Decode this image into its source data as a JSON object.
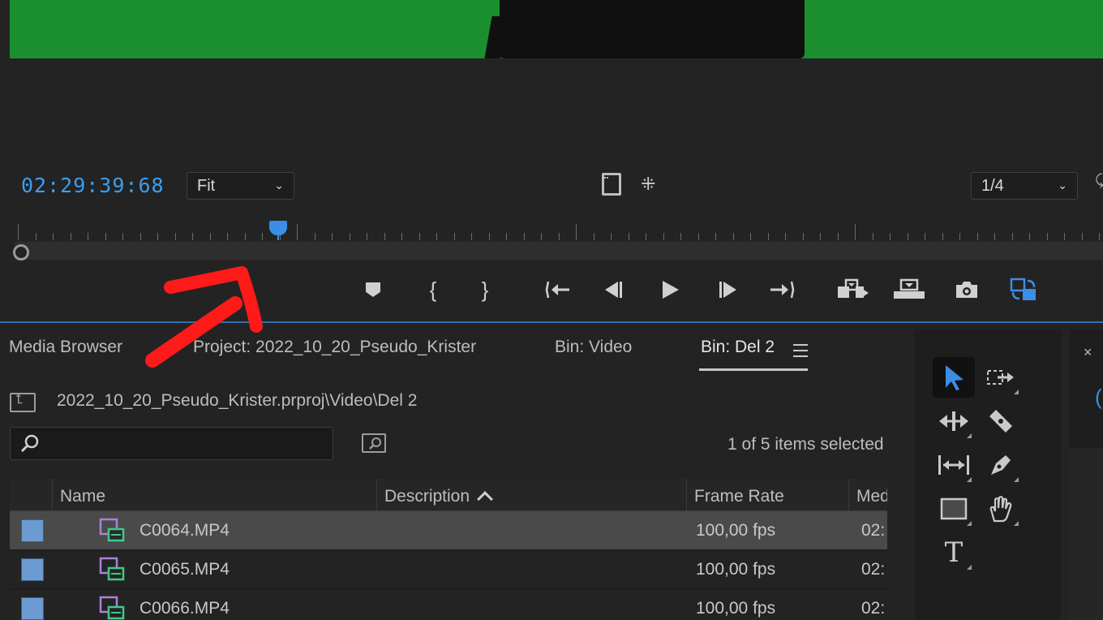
{
  "monitor": {
    "timecode": "02:29:39:68",
    "zoom_select": "Fit",
    "resolution_select": "1/4"
  },
  "transport": {
    "marker_icon": "marker-icon",
    "mark_in": "{",
    "mark_out": "}",
    "go_to_in": "{←",
    "step_back": "◀|",
    "play": "▶",
    "step_forward": "|▶",
    "go_to_out": "→}",
    "insert_icon": "insert-icon",
    "overwrite_icon": "overwrite-icon",
    "camera_icon": "camera-icon",
    "proxy_icon": "proxy-toggle-icon"
  },
  "tabs": [
    {
      "label": "Media Browser"
    },
    {
      "label": "Project: 2022_10_20_Pseudo_Krister"
    },
    {
      "label": "Bin: Video"
    },
    {
      "label": "Bin: Del 2"
    }
  ],
  "project": {
    "path": "2022_10_20_Pseudo_Krister.prproj\\Video\\Del 2",
    "search_placeholder": "",
    "selection_status": "1 of 5 items selected"
  },
  "table": {
    "columns": [
      "Name",
      "Description",
      "Frame Rate",
      "Med"
    ],
    "rows": [
      {
        "name": "C0064.MP4",
        "description": "",
        "frame_rate": "100,00 fps",
        "media": "02:",
        "selected": true
      },
      {
        "name": "C0065.MP4",
        "description": "",
        "frame_rate": "100,00 fps",
        "media": "02:",
        "selected": false
      },
      {
        "name": "C0066.MP4",
        "description": "",
        "frame_rate": "100,00 fps",
        "media": "02:",
        "selected": false
      }
    ]
  },
  "tools": {
    "type_tool": "T",
    "close": "×",
    "partial_panel_glyph": "("
  },
  "colors": {
    "accent_blue": "#3a8ee6",
    "green_screen": "#1b8f2e",
    "annotation_red": "#ff1a1a",
    "label_swatch": "#6c9bd2"
  }
}
